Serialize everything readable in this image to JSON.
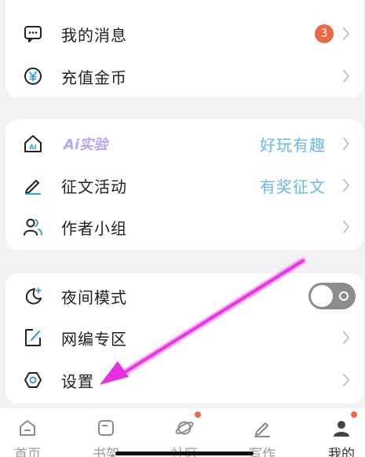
{
  "group1": {
    "messages": {
      "label": "我的消息",
      "badge": "3",
      "icon": "message-bubble-icon"
    },
    "recharge": {
      "label": "充值金币",
      "icon": "yuan-coin-icon"
    }
  },
  "group2": {
    "ai": {
      "label": "Ai实验",
      "right": "好玩有趣",
      "icon": "ai-home-icon"
    },
    "contest": {
      "label": "征文活动",
      "right": "有奖征文",
      "icon": "pen-icon"
    },
    "authors": {
      "label": "作者小组",
      "icon": "people-icon"
    }
  },
  "group3": {
    "night": {
      "label": "夜间模式",
      "toggle_on": false,
      "icon": "moon-star-icon"
    },
    "editor": {
      "label": "网编专区",
      "icon": "edit-square-icon"
    },
    "settings": {
      "label": "设置",
      "icon": "hexagon-settings-icon"
    }
  },
  "tabbar": {
    "tabs": [
      {
        "label": "首页",
        "icon": "home-icon"
      },
      {
        "label": "书架",
        "icon": "bookshelf-icon"
      },
      {
        "label": "社区",
        "icon": "planet-icon"
      },
      {
        "label": "写作",
        "icon": "pencil-icon"
      },
      {
        "label": "我的",
        "icon": "profile-icon"
      }
    ]
  },
  "colors": {
    "accent_blue": "#6cb8e8",
    "badge_red": "#ea6a45",
    "arrow_magenta": "#e52fe0"
  }
}
